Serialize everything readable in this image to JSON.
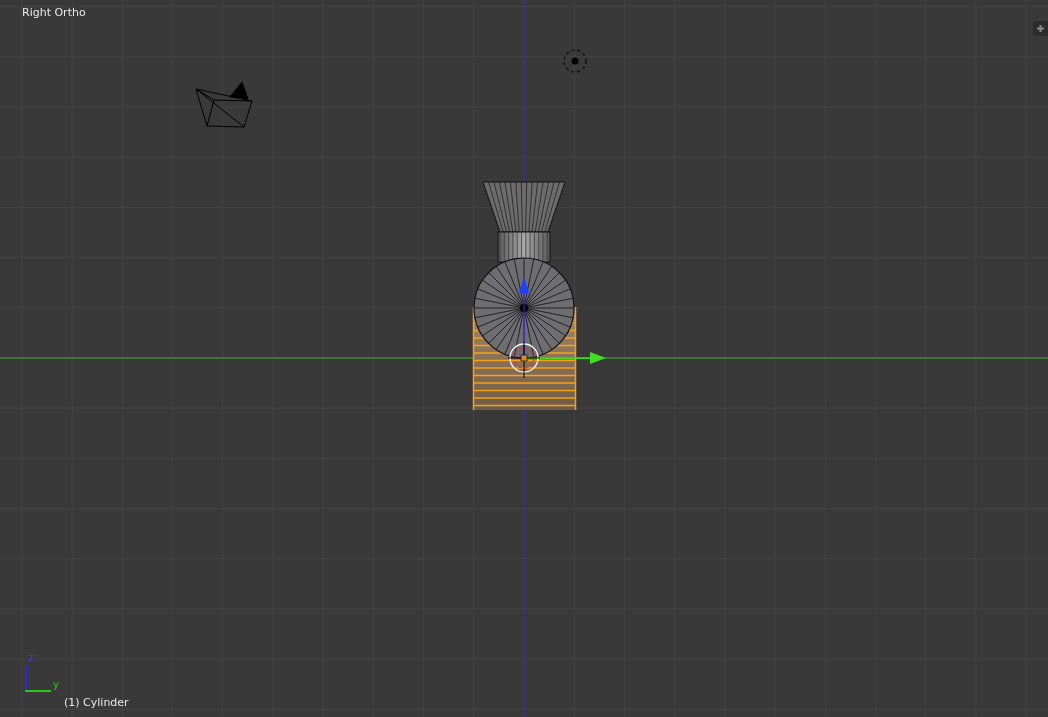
{
  "viewport": {
    "view_name": "Right Ortho",
    "object_label": "(1) Cylinder",
    "axis_gizmo": {
      "vertical": "z",
      "horizontal": "y"
    }
  }
}
